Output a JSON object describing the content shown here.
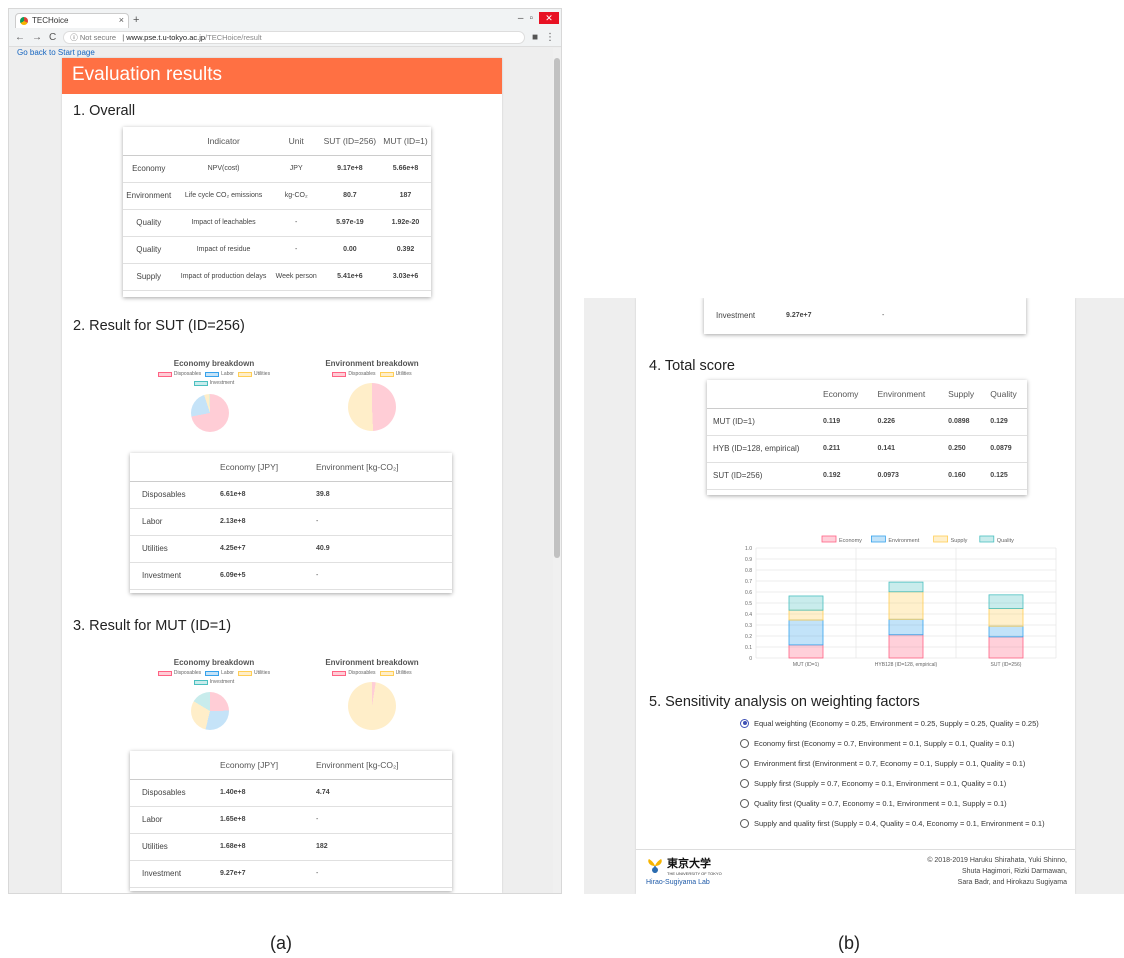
{
  "browser": {
    "tab_title": "TECHoice",
    "url_secure_label": "Not secure",
    "url_host": "www.pse.t.u-tokyo.ac.jp",
    "url_path": "/TECHoice/result"
  },
  "back_link": "Go back to Start page",
  "header_title": "Evaluation results",
  "section_overall": {
    "title": "1. Overall",
    "columns": [
      "",
      "Indicator",
      "Unit",
      "SUT (ID=256)",
      "MUT (ID=1)"
    ],
    "rows": [
      {
        "category": "Economy",
        "indicator": "NPV(cost)",
        "unit": "JPY",
        "sut": "9.17e+8",
        "mut": "5.66e+8"
      },
      {
        "category": "Environment",
        "indicator": "Life cycle CO₂ emissions",
        "unit": "kg-CO₂",
        "sut": "80.7",
        "mut": "187"
      },
      {
        "category": "Quality",
        "indicator": "Impact of leachables",
        "unit": "-",
        "sut": "5.97e-19",
        "mut": "1.92e-20"
      },
      {
        "category": "Quality",
        "indicator": "Impact of residue",
        "unit": "-",
        "sut": "0.00",
        "mut": "0.392"
      },
      {
        "category": "Supply",
        "indicator": "Impact of production delays",
        "unit": "Week person",
        "sut": "5.41e+6",
        "mut": "3.03e+6"
      }
    ]
  },
  "section_sut": {
    "title": "2. Result for SUT (ID=256)",
    "economy_title": "Economy breakdown",
    "environment_title": "Environment breakdown",
    "economy_legend": [
      "Disposables",
      "Labor",
      "Utilities",
      "Investment"
    ],
    "environment_legend": [
      "Disposables",
      "Utilities"
    ],
    "columns": [
      "",
      "Economy [JPY]",
      "Environment [kg-CO₂]"
    ],
    "rows": [
      {
        "item": "Disposables",
        "economy": "6.61e+8",
        "environment": "39.8"
      },
      {
        "item": "Labor",
        "economy": "2.13e+8",
        "environment": "-"
      },
      {
        "item": "Utilities",
        "economy": "4.25e+7",
        "environment": "40.9"
      },
      {
        "item": "Investment",
        "economy": "6.09e+5",
        "environment": "-"
      }
    ]
  },
  "section_mut": {
    "title": "3. Result for MUT (ID=1)",
    "economy_title": "Economy breakdown",
    "environment_title": "Environment breakdown",
    "economy_legend": [
      "Disposables",
      "Labor",
      "Utilities",
      "Investment"
    ],
    "environment_legend": [
      "Disposables",
      "Utilities"
    ],
    "columns": [
      "",
      "Economy [JPY]",
      "Environment [kg-CO₂]"
    ],
    "rows": [
      {
        "item": "Disposables",
        "economy": "1.40e+8",
        "environment": "4.74"
      },
      {
        "item": "Labor",
        "economy": "1.65e+8",
        "environment": "-"
      },
      {
        "item": "Utilities",
        "economy": "1.68e+8",
        "environment": "182"
      },
      {
        "item": "Investment",
        "economy": "9.27e+7",
        "environment": "-"
      }
    ]
  },
  "top_partial_row": {
    "item": "Investment",
    "economy": "9.27e+7",
    "environment": "-"
  },
  "section_total": {
    "title": "4. Total score",
    "columns": [
      "",
      "Economy",
      "Environment",
      "Supply",
      "Quality"
    ],
    "rows": [
      {
        "name": "MUT (ID=1)",
        "economy": "0.119",
        "environment": "0.226",
        "supply": "0.0898",
        "quality": "0.129"
      },
      {
        "name": "HYB (ID=128, empirical)",
        "economy": "0.211",
        "environment": "0.141",
        "supply": "0.250",
        "quality": "0.0879"
      },
      {
        "name": "SUT (ID=256)",
        "economy": "0.192",
        "environment": "0.0973",
        "supply": "0.160",
        "quality": "0.125"
      }
    ]
  },
  "chart_data": {
    "type": "bar",
    "stacked": true,
    "categories": [
      "MUT (ID=1)",
      "HYB128 (ID=128, empirical)",
      "SUT (ID=256)"
    ],
    "series": [
      {
        "name": "Economy",
        "values": [
          0.119,
          0.211,
          0.192
        ]
      },
      {
        "name": "Environment",
        "values": [
          0.226,
          0.141,
          0.0973
        ]
      },
      {
        "name": "Supply",
        "values": [
          0.0898,
          0.25,
          0.16
        ]
      },
      {
        "name": "Quality",
        "values": [
          0.129,
          0.0879,
          0.125
        ]
      }
    ],
    "ylim": [
      0,
      1.0
    ],
    "yticks": [
      "1.0",
      "0.9",
      "0.8",
      "0.7",
      "0.6",
      "0.5",
      "0.4",
      "0.3",
      "0.2",
      "0.1",
      "0"
    ],
    "legend_position": "top",
    "colors": {
      "Economy": "#ff6384",
      "Environment": "#36a2eb",
      "Supply": "#ffce56",
      "Quality": "#4bc0c0"
    }
  },
  "section_sensitivity": {
    "title": "5. Sensitivity analysis on weighting factors",
    "options": [
      {
        "label": "Equal weighting (Economy = 0.25, Environment = 0.25, Supply = 0.25, Quality = 0.25)",
        "selected": true
      },
      {
        "label": "Economy first (Economy = 0.7, Environment = 0.1, Supply = 0.1, Quality = 0.1)",
        "selected": false
      },
      {
        "label": "Environment first (Environment = 0.7, Economy = 0.1, Supply = 0.1, Quality = 0.1)",
        "selected": false
      },
      {
        "label": "Supply first (Supply = 0.7, Economy = 0.1, Environment = 0.1, Quality = 0.1)",
        "selected": false
      },
      {
        "label": "Quality first (Quality = 0.7, Economy = 0.1, Environment = 0.1, Supply = 0.1)",
        "selected": false
      },
      {
        "label": "Supply and quality first (Supply = 0.4, Quality = 0.4, Economy = 0.1, Environment = 0.1)",
        "selected": false
      }
    ]
  },
  "footer": {
    "logo_text": "東京大学",
    "logo_sub": "THE UNIVERSITY OF TOKYO",
    "lab_link": "Hirao-Sugiyama Lab",
    "copyright_lines": [
      "© 2018-2019 Haruku Shirahata, Yuki Shinno,",
      "Shuta Hagimori, Rizki Darmawan,",
      "Sara Badr, and Hirokazu Sugiyama"
    ]
  },
  "captions": {
    "a": "(a)",
    "b": "(b)"
  }
}
